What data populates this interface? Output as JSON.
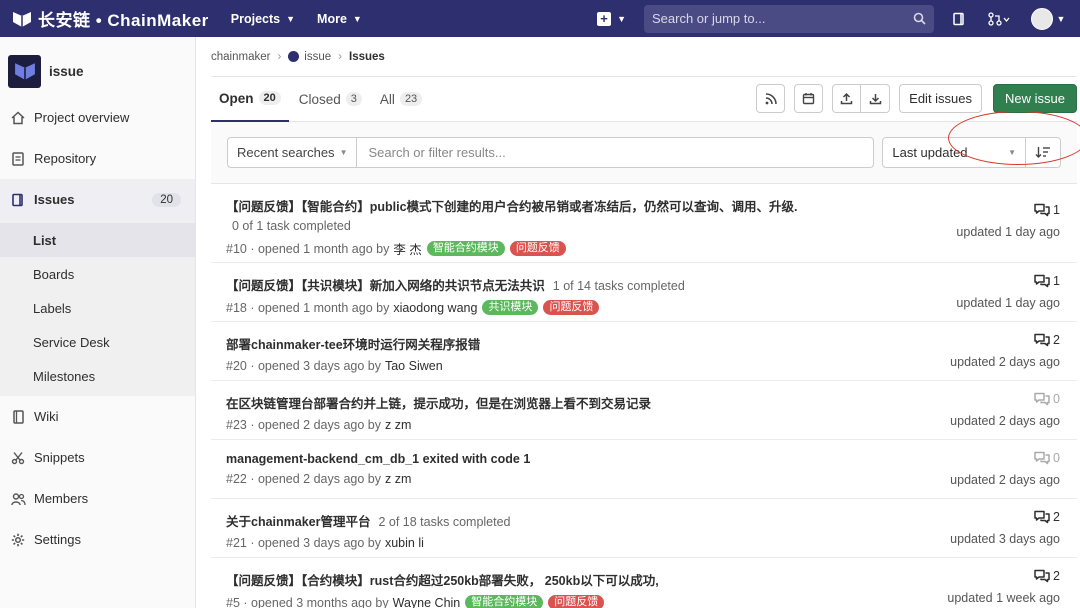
{
  "nav": {
    "logo_text": "长安链 • ChainMaker",
    "projects": "Projects",
    "more": "More",
    "search_placeholder": "Search or jump to..."
  },
  "sidebar": {
    "project_name": "issue",
    "items": [
      {
        "label": "Project overview"
      },
      {
        "label": "Repository"
      },
      {
        "label": "Issues",
        "count": "20"
      },
      {
        "label": "Wiki"
      },
      {
        "label": "Snippets"
      },
      {
        "label": "Members"
      },
      {
        "label": "Settings"
      }
    ],
    "issues_sub": [
      "List",
      "Boards",
      "Labels",
      "Service Desk",
      "Milestones"
    ]
  },
  "breadcrumb": {
    "group": "chainmaker",
    "project": "issue",
    "current": "Issues"
  },
  "tabs": [
    {
      "label": "Open",
      "count": "20"
    },
    {
      "label": "Closed",
      "count": "3"
    },
    {
      "label": "All",
      "count": "23"
    }
  ],
  "buttons": {
    "edit": "Edit issues",
    "new": "New issue"
  },
  "filter": {
    "recent": "Recent searches",
    "placeholder": "Search or filter results...",
    "sort": "Last updated"
  },
  "colors": {
    "label_green": "#5cb85c",
    "label_red": "#d9534f",
    "new_issue": "#2f7f4f",
    "annotation_ring": "#d9382a"
  },
  "issues": [
    {
      "title": "【问题反馈】【智能合约】public模式下创建的用户合约被吊销或者冻结后，仍然可以查询、调用、升级.",
      "tasks": "0 of 1 task completed",
      "ref": "#10 · opened 1 month ago by",
      "author": "李 杰",
      "labels": [
        "智能合约模块",
        "问题反馈"
      ],
      "comments": "1",
      "updated": "updated 1 day ago"
    },
    {
      "title": "【问题反馈】【共识模块】新加入网络的共识节点无法共识",
      "tasks": "1 of 14 tasks completed",
      "ref": "#18 · opened 1 month ago by",
      "author": "xiaodong wang",
      "labels": [
        "共识模块",
        "问题反馈"
      ],
      "comments": "1",
      "updated": "updated 1 day ago"
    },
    {
      "title": "部署chainmaker-tee环境时运行网关程序报错",
      "tasks": "",
      "ref": "#20 · opened 3 days ago by",
      "author": "Tao Siwen",
      "labels": [],
      "comments": "2",
      "updated": "updated 2 days ago"
    },
    {
      "title": "在区块链管理台部署合约并上链，提示成功，但是在浏览器上看不到交易记录",
      "tasks": "",
      "ref": "#23 · opened 2 days ago by",
      "author": "z zm",
      "labels": [],
      "comments": "0",
      "updated": "updated 2 days ago"
    },
    {
      "title": "management-backend_cm_db_1 exited with code 1",
      "tasks": "",
      "ref": "#22 · opened 2 days ago by",
      "author": "z zm",
      "labels": [],
      "comments": "0",
      "updated": "updated 2 days ago"
    },
    {
      "title": "关于chainmaker管理平台",
      "tasks": "2 of 18 tasks completed",
      "ref": "#21 · opened 3 days ago by",
      "author": "xubin li",
      "labels": [],
      "comments": "2",
      "updated": "updated 3 days ago"
    },
    {
      "title": "【问题反馈】【合约模块】rust合约超过250kb部署失败， 250kb以下可以成功,",
      "tasks": "",
      "ref": "#5 · opened 3 months ago by",
      "author": "Wayne Chin",
      "labels": [
        "智能合约模块",
        "问题反馈"
      ],
      "comments": "2",
      "updated": "updated 1 week ago"
    }
  ]
}
